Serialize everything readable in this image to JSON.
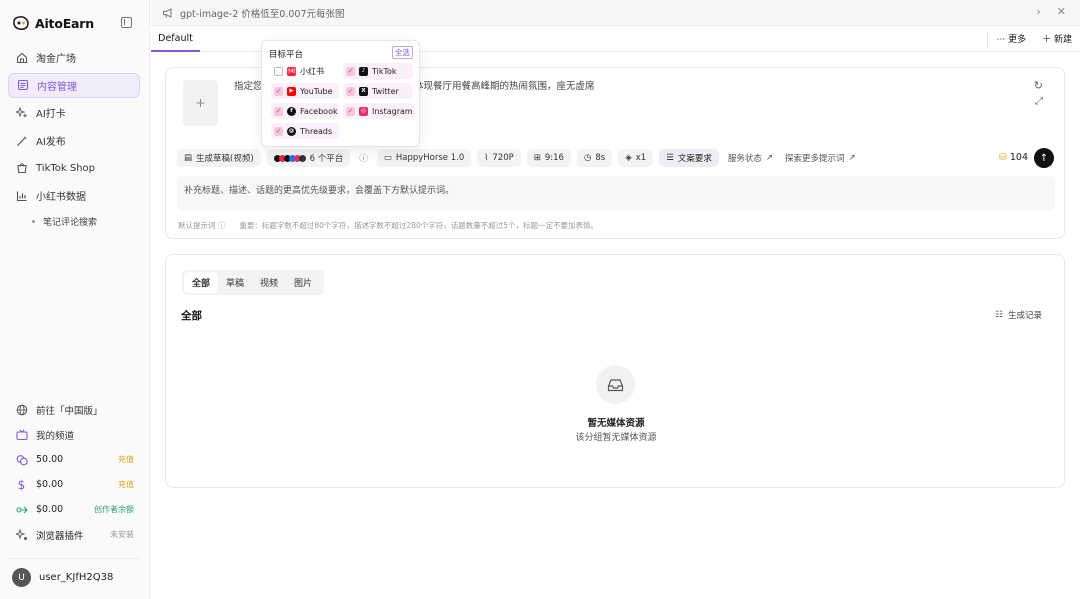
{
  "brand": {
    "name": "AitoEarn"
  },
  "sidebar": {
    "items": [
      {
        "label": "淘金广场",
        "icon": "home-icon"
      },
      {
        "label": "内容管理",
        "icon": "content-icon",
        "active": true
      },
      {
        "label": "AI打卡",
        "icon": "sparkle-icon"
      },
      {
        "label": "AI发布",
        "icon": "magic-icon"
      },
      {
        "label": "TikTok Shop",
        "icon": "shop-icon"
      },
      {
        "label": "小红书数据",
        "icon": "bar-chart-icon"
      }
    ],
    "sub_item": "笔记评论搜索",
    "bottom": {
      "region": "前往「中国版」",
      "channel": "我的频道",
      "credits": [
        {
          "value": "50.00",
          "tag": "充值"
        },
        {
          "value": "$0.00",
          "tag": "充值"
        },
        {
          "value": "$0.00",
          "tag": "创作者余额"
        }
      ],
      "plugin": {
        "label": "浏览器插件",
        "status": "未安装"
      }
    },
    "user": {
      "initial": "U",
      "name": "user_KJfH2Q38"
    }
  },
  "topbar": {
    "announcement": "gpt-image-2 价格低至0.007元每张图"
  },
  "tabs": {
    "active": "Default",
    "more": "更多",
    "new": "新建"
  },
  "composer": {
    "prompt_left": "指定您",
    "prompt_right": "体现餐厅用餐高峰期的热闹氛围，座无虚席",
    "toolbar": {
      "mode": "生成草稿(视频)",
      "platforms": "6 个平台",
      "model": "HappyHorse 1.0",
      "resolution": "720P",
      "ratio": "9:16",
      "duration": "8s",
      "count": "x1",
      "copy_req": "文案要求",
      "service": "服务状态",
      "explore": "探索更多提示词"
    },
    "credits": "104",
    "supplement_placeholder": "补充标题、描述、话题的更高优先级要求，会覆盖下方默认提示词。",
    "hint_label": "默认提示词",
    "hint_text": "重要：标题字数不超过80个字符，描述字数不超过280个字符，话题数量不超过5个，标题一定不要加表情。"
  },
  "dropdown": {
    "title": "目标平台",
    "select_all": "全选",
    "platforms": [
      {
        "name": "小红书",
        "checked": false,
        "color": "#ff2442"
      },
      {
        "name": "TikTok",
        "checked": true,
        "color": "#111111"
      },
      {
        "name": "YouTube",
        "checked": true,
        "color": "#ff0000"
      },
      {
        "name": "Twitter",
        "checked": true,
        "color": "#111111"
      },
      {
        "name": "Facebook",
        "checked": true,
        "color": "#111111"
      },
      {
        "name": "Instagram",
        "checked": true,
        "color": "#e1306c"
      },
      {
        "name": "Threads",
        "checked": true,
        "color": "#111111"
      }
    ]
  },
  "media": {
    "tabs": [
      "全部",
      "草稿",
      "视频",
      "图片"
    ],
    "title": "全部",
    "record": "生成记录",
    "empty_title": "暂无媒体资源",
    "empty_sub": "该分组暂无媒体资源"
  },
  "colors": {
    "accent": "#7b5ae0",
    "active_bg": "#f1ecfc",
    "credit_tag": "#e0a31a",
    "creator_tag": "#2ea36a"
  }
}
